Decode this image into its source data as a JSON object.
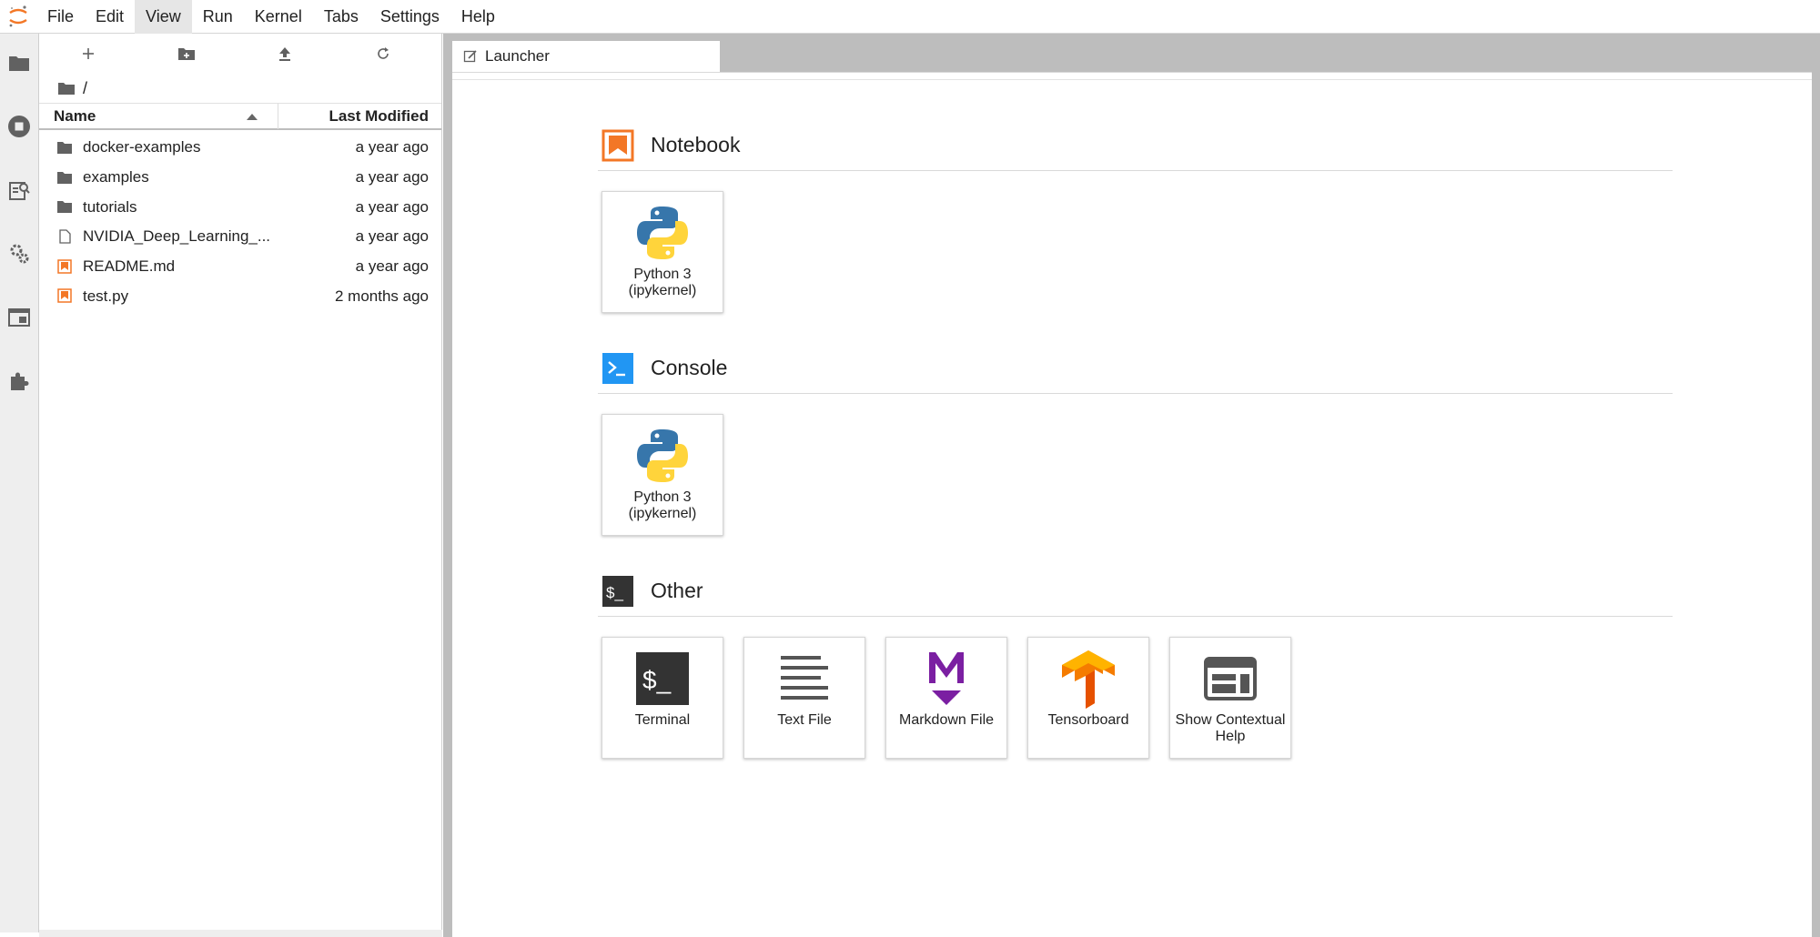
{
  "menubar": {
    "items": [
      {
        "label": "File"
      },
      {
        "label": "Edit"
      },
      {
        "label": "View"
      },
      {
        "label": "Run"
      },
      {
        "label": "Kernel"
      },
      {
        "label": "Tabs"
      },
      {
        "label": "Settings"
      },
      {
        "label": "Help"
      }
    ],
    "active": "View"
  },
  "activitybar": {
    "icons": [
      "folder-icon",
      "running-icon",
      "property-inspector-icon",
      "settings-gear-icon",
      "tabs-icon",
      "extension-icon"
    ]
  },
  "filebrowser": {
    "breadcrumb": "/",
    "columns": {
      "name": "Name",
      "modified": "Last Modified"
    },
    "files": [
      {
        "name": "docker-examples",
        "modified": "a year ago",
        "type": "folder"
      },
      {
        "name": "examples",
        "modified": "a year ago",
        "type": "folder"
      },
      {
        "name": "tutorials",
        "modified": "a year ago",
        "type": "folder"
      },
      {
        "name": "NVIDIA_Deep_Learning_...",
        "modified": "a year ago",
        "type": "file"
      },
      {
        "name": "README.md",
        "modified": "a year ago",
        "type": "markdown"
      },
      {
        "name": "test.py",
        "modified": "2 months ago",
        "type": "markdown"
      }
    ]
  },
  "tabs": [
    {
      "label": "Launcher"
    }
  ],
  "launcher": {
    "sections": [
      {
        "title": "Notebook",
        "cards": [
          {
            "label": "Python 3 (ipykernel)"
          }
        ]
      },
      {
        "title": "Console",
        "cards": [
          {
            "label": "Python 3 (ipykernel)"
          }
        ]
      },
      {
        "title": "Other",
        "cards": [
          {
            "label": "Terminal"
          },
          {
            "label": "Text File"
          },
          {
            "label": "Markdown File"
          },
          {
            "label": "Tensorboard"
          },
          {
            "label": "Show Contextual Help"
          }
        ]
      }
    ]
  },
  "colors": {
    "accent_orange": "#f37726",
    "console_blue": "#2196f3",
    "markdown_purple": "#7b1fa2",
    "tensorboard_orange": "#f57c00",
    "python_blue": "#3776ab",
    "python_yellow": "#ffd43b"
  }
}
